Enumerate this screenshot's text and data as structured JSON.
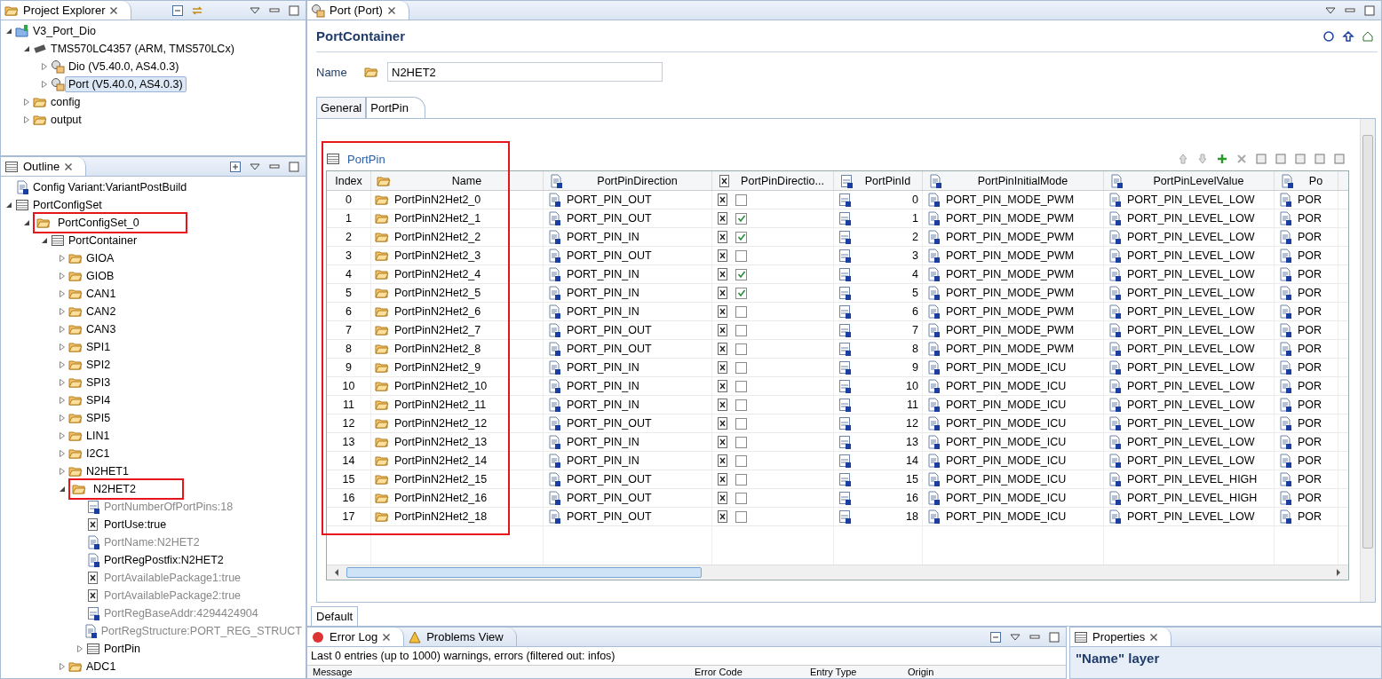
{
  "project_explorer": {
    "title": "Project Explorer",
    "tree": [
      {
        "label": "V3_Port_Dio",
        "kind": "project",
        "expanded": true,
        "selected": false,
        "children": [
          {
            "label": "TMS570LC4357 (ARM, TMS570LCx)",
            "kind": "chip",
            "expanded": true,
            "selected": false,
            "children": [
              {
                "label": "Dio (V5.40.0, AS4.0.3)",
                "kind": "module",
                "expanded": false,
                "selected": false
              },
              {
                "label": "Port (V5.40.0, AS4.0.3)",
                "kind": "module",
                "expanded": false,
                "selected": true
              }
            ]
          },
          {
            "label": "config",
            "kind": "folder",
            "expanded": false,
            "selected": false
          },
          {
            "label": "output",
            "kind": "folder",
            "expanded": false,
            "selected": false
          }
        ]
      }
    ]
  },
  "outline": {
    "title": "Outline",
    "tree": [
      {
        "label": "Config Variant:VariantPostBuild",
        "kind": "doc"
      },
      {
        "label": "PortConfigSet",
        "kind": "table",
        "expanded": true,
        "children": [
          {
            "label": "PortConfigSet_0",
            "kind": "folder",
            "expanded": true,
            "highlighted": true,
            "children": [
              {
                "label": "PortContainer",
                "kind": "table",
                "expanded": true,
                "children": [
                  {
                    "label": "GIOA",
                    "kind": "folder",
                    "expanded": false
                  },
                  {
                    "label": "GIOB",
                    "kind": "folder",
                    "expanded": false
                  },
                  {
                    "label": "CAN1",
                    "kind": "folder",
                    "expanded": false
                  },
                  {
                    "label": "CAN2",
                    "kind": "folder",
                    "expanded": false
                  },
                  {
                    "label": "CAN3",
                    "kind": "folder",
                    "expanded": false
                  },
                  {
                    "label": "SPI1",
                    "kind": "folder",
                    "expanded": false
                  },
                  {
                    "label": "SPI2",
                    "kind": "folder",
                    "expanded": false
                  },
                  {
                    "label": "SPI3",
                    "kind": "folder",
                    "expanded": false
                  },
                  {
                    "label": "SPI4",
                    "kind": "folder",
                    "expanded": false
                  },
                  {
                    "label": "SPI5",
                    "kind": "folder",
                    "expanded": false
                  },
                  {
                    "label": "LIN1",
                    "kind": "folder",
                    "expanded": false
                  },
                  {
                    "label": "I2C1",
                    "kind": "folder",
                    "expanded": false
                  },
                  {
                    "label": "N2HET1",
                    "kind": "folder",
                    "expanded": false
                  },
                  {
                    "label": "N2HET2",
                    "kind": "folder",
                    "expanded": true,
                    "highlighted": true,
                    "children": [
                      {
                        "label": "PortNumberOfPortPins:18",
                        "kind": "int",
                        "disabled": true
                      },
                      {
                        "label": "PortUse:true",
                        "kind": "bool",
                        "disabled": false
                      },
                      {
                        "label": "PortName:N2HET2",
                        "kind": "doc",
                        "disabled": true
                      },
                      {
                        "label": "PortRegPostfix:N2HET2",
                        "kind": "doc",
                        "disabled": false
                      },
                      {
                        "label": "PortAvailablePackage1:true",
                        "kind": "bool",
                        "disabled": true
                      },
                      {
                        "label": "PortAvailablePackage2:true",
                        "kind": "bool",
                        "disabled": true
                      },
                      {
                        "label": "PortRegBaseAddr:4294424904",
                        "kind": "int",
                        "disabled": true
                      },
                      {
                        "label": "PortRegStructure:PORT_REG_STRUCT",
                        "kind": "doc",
                        "disabled": true
                      },
                      {
                        "label": "PortPin",
                        "kind": "table",
                        "expanded": false
                      }
                    ]
                  },
                  {
                    "label": "ADC1",
                    "kind": "folder",
                    "expanded": false
                  }
                ]
              }
            ]
          }
        ]
      }
    ]
  },
  "editor": {
    "tab": "Port (Port)",
    "heading": "PortContainer",
    "name_label": "Name",
    "name_value": "N2HET2",
    "tabs": [
      {
        "label": "General",
        "selected": false
      },
      {
        "label": "PortPin",
        "selected": true
      }
    ],
    "table": {
      "title": "PortPin",
      "highlighted": true,
      "columns": [
        {
          "label": "Index",
          "kind": "index"
        },
        {
          "label": "Name",
          "kind": "folder"
        },
        {
          "label": "PortPinDirection",
          "kind": "doc"
        },
        {
          "label": "PortPinDirectio...",
          "kind": "bool"
        },
        {
          "label": "PortPinId",
          "kind": "int"
        },
        {
          "label": "PortPinInitialMode",
          "kind": "doc"
        },
        {
          "label": "PortPinLevelValue",
          "kind": "doc"
        },
        {
          "label": "Po",
          "kind": "doc"
        }
      ],
      "rows": [
        {
          "index": "0",
          "name": "PortPinN2Het2_0",
          "direction": "PORT_PIN_OUT",
          "changeable": false,
          "id": "0",
          "mode": "PORT_PIN_MODE_PWM",
          "level_value": "PORT_PIN_LEVEL_LOW",
          "column_8": "POR"
        },
        {
          "index": "1",
          "name": "PortPinN2Het2_1",
          "direction": "PORT_PIN_OUT",
          "changeable": true,
          "id": "1",
          "mode": "PORT_PIN_MODE_PWM",
          "level_value": "PORT_PIN_LEVEL_LOW",
          "column_8": "POR"
        },
        {
          "index": "2",
          "name": "PortPinN2Het2_2",
          "direction": "PORT_PIN_IN",
          "changeable": true,
          "id": "2",
          "mode": "PORT_PIN_MODE_PWM",
          "level_value": "PORT_PIN_LEVEL_LOW",
          "column_8": "POR"
        },
        {
          "index": "3",
          "name": "PortPinN2Het2_3",
          "direction": "PORT_PIN_OUT",
          "changeable": false,
          "id": "3",
          "mode": "PORT_PIN_MODE_PWM",
          "level_value": "PORT_PIN_LEVEL_LOW",
          "column_8": "POR"
        },
        {
          "index": "4",
          "name": "PortPinN2Het2_4",
          "direction": "PORT_PIN_IN",
          "changeable": true,
          "id": "4",
          "mode": "PORT_PIN_MODE_PWM",
          "level_value": "PORT_PIN_LEVEL_LOW",
          "column_8": "POR"
        },
        {
          "index": "5",
          "name": "PortPinN2Het2_5",
          "direction": "PORT_PIN_IN",
          "changeable": true,
          "id": "5",
          "mode": "PORT_PIN_MODE_PWM",
          "level_value": "PORT_PIN_LEVEL_LOW",
          "column_8": "POR"
        },
        {
          "index": "6",
          "name": "PortPinN2Het2_6",
          "direction": "PORT_PIN_IN",
          "changeable": false,
          "id": "6",
          "mode": "PORT_PIN_MODE_PWM",
          "level_value": "PORT_PIN_LEVEL_LOW",
          "column_8": "POR"
        },
        {
          "index": "7",
          "name": "PortPinN2Het2_7",
          "direction": "PORT_PIN_OUT",
          "changeable": false,
          "id": "7",
          "mode": "PORT_PIN_MODE_PWM",
          "level_value": "PORT_PIN_LEVEL_LOW",
          "column_8": "POR"
        },
        {
          "index": "8",
          "name": "PortPinN2Het2_8",
          "direction": "PORT_PIN_OUT",
          "changeable": false,
          "id": "8",
          "mode": "PORT_PIN_MODE_PWM",
          "level_value": "PORT_PIN_LEVEL_LOW",
          "column_8": "POR"
        },
        {
          "index": "9",
          "name": "PortPinN2Het2_9",
          "direction": "PORT_PIN_IN",
          "changeable": false,
          "id": "9",
          "mode": "PORT_PIN_MODE_ICU",
          "level_value": "PORT_PIN_LEVEL_LOW",
          "column_8": "POR"
        },
        {
          "index": "10",
          "name": "PortPinN2Het2_10",
          "direction": "PORT_PIN_IN",
          "changeable": false,
          "id": "10",
          "mode": "PORT_PIN_MODE_ICU",
          "level_value": "PORT_PIN_LEVEL_LOW",
          "column_8": "POR"
        },
        {
          "index": "11",
          "name": "PortPinN2Het2_11",
          "direction": "PORT_PIN_IN",
          "changeable": false,
          "id": "11",
          "mode": "PORT_PIN_MODE_ICU",
          "level_value": "PORT_PIN_LEVEL_LOW",
          "column_8": "POR"
        },
        {
          "index": "12",
          "name": "PortPinN2Het2_12",
          "direction": "PORT_PIN_OUT",
          "changeable": false,
          "id": "12",
          "mode": "PORT_PIN_MODE_ICU",
          "level_value": "PORT_PIN_LEVEL_LOW",
          "column_8": "POR"
        },
        {
          "index": "13",
          "name": "PortPinN2Het2_13",
          "direction": "PORT_PIN_IN",
          "changeable": false,
          "id": "13",
          "mode": "PORT_PIN_MODE_ICU",
          "level_value": "PORT_PIN_LEVEL_LOW",
          "column_8": "POR"
        },
        {
          "index": "14",
          "name": "PortPinN2Het2_14",
          "direction": "PORT_PIN_IN",
          "changeable": false,
          "id": "14",
          "mode": "PORT_PIN_MODE_ICU",
          "level_value": "PORT_PIN_LEVEL_LOW",
          "column_8": "POR"
        },
        {
          "index": "15",
          "name": "PortPinN2Het2_15",
          "direction": "PORT_PIN_OUT",
          "changeable": false,
          "id": "15",
          "mode": "PORT_PIN_MODE_ICU",
          "level_value": "PORT_PIN_LEVEL_HIGH",
          "column_8": "POR"
        },
        {
          "index": "16",
          "name": "PortPinN2Het2_16",
          "direction": "PORT_PIN_OUT",
          "changeable": false,
          "id": "16",
          "mode": "PORT_PIN_MODE_ICU",
          "level_value": "PORT_PIN_LEVEL_HIGH",
          "column_8": "POR"
        },
        {
          "index": "17",
          "name": "PortPinN2Het2_18",
          "direction": "PORT_PIN_OUT",
          "changeable": false,
          "id": "18",
          "mode": "PORT_PIN_MODE_ICU",
          "level_value": "PORT_PIN_LEVEL_LOW",
          "column_8": "POR"
        }
      ]
    },
    "bottom_tab": "Default"
  },
  "error_log": {
    "tabs": [
      {
        "label": "Error Log",
        "selected": true
      },
      {
        "label": "Problems View",
        "selected": false
      }
    ],
    "summary": "Last 0 entries (up to 1000) warnings, errors (filtered out: infos)",
    "columns": [
      "Message",
      "Error Code",
      "Entry Type",
      "Origin"
    ]
  },
  "properties": {
    "title": "Properties",
    "heading": "\"Name\" layer"
  }
}
